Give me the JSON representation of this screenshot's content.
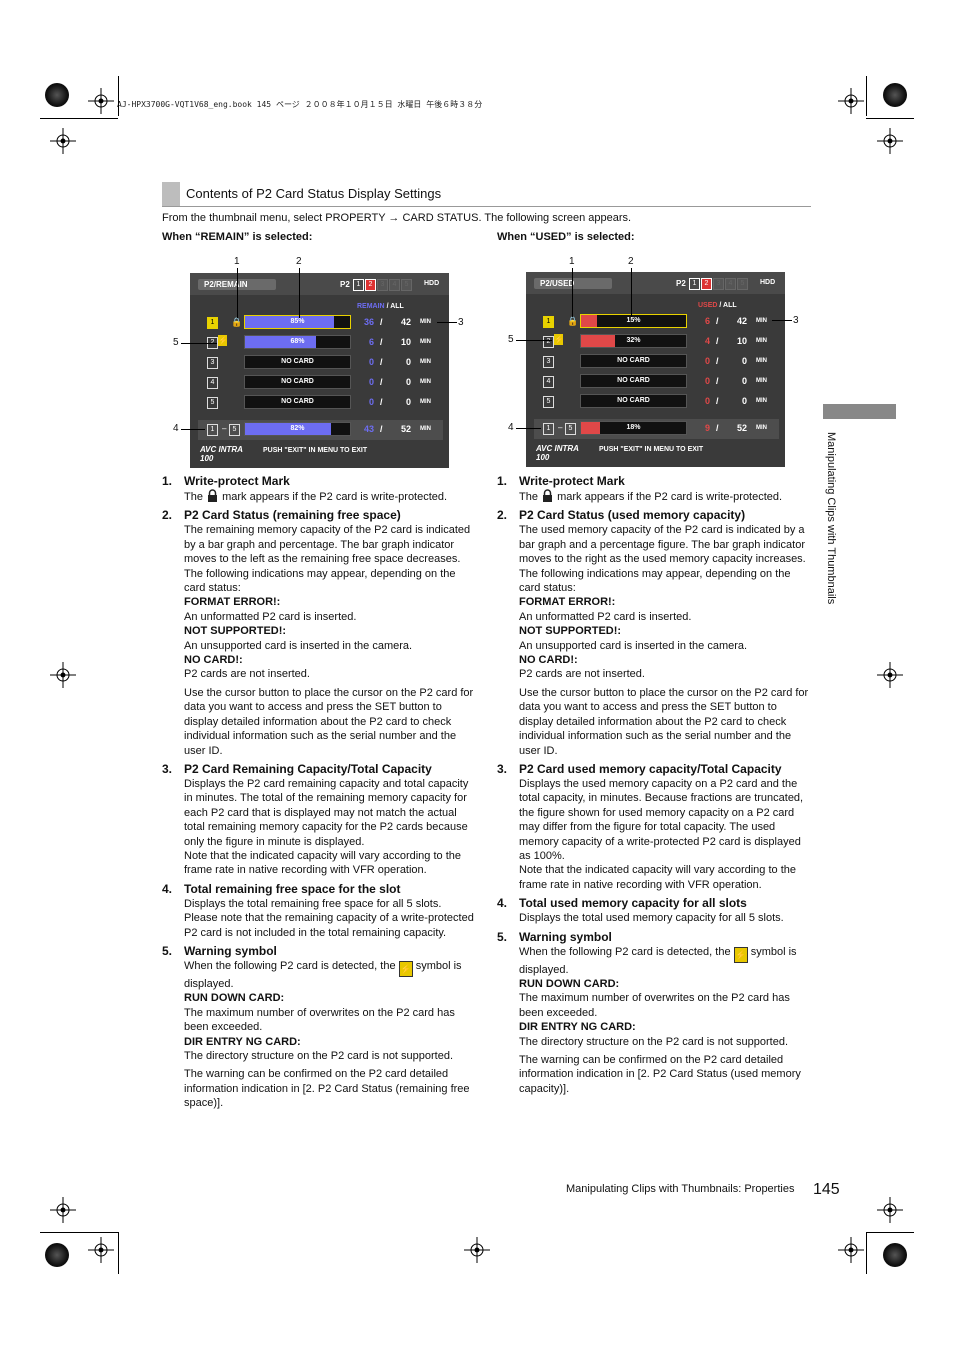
{
  "header_line": "AJ-HPX3700G-VQT1V68_eng.book  145 ページ  ２００８年１０月１５日  水曜日  午後６時３８分",
  "section_title": "Contents of P2 Card Status Display Settings",
  "intro": "From the thumbnail menu, select PROPERTY → CARD STATUS. The following screen appears.",
  "left_caption": "When “REMAIN” is selected:",
  "right_caption": "When “USED” is selected:",
  "screen_common": {
    "p2": "P2",
    "hdd": "HDD",
    "slash": "/",
    "min": "MIN",
    "all": "ALL",
    "push_exit": "PUSH \"EXIT\" IN MENU TO EXIT",
    "avc": "AVC INTRA 100",
    "total_from": "1",
    "total_to": "5",
    "slot_nums": [
      "1",
      "2",
      "3",
      "4",
      "5"
    ],
    "callouts": [
      "1",
      "2",
      "3",
      "4",
      "5"
    ]
  },
  "screen_remain": {
    "tab": "P2/REMAIN",
    "col_label": "REMAIN",
    "accent": "#6d6df2",
    "rows": [
      {
        "bar": "85%",
        "fill": 0.85,
        "v1": "36",
        "v2": "42"
      },
      {
        "bar": "68%",
        "fill": 0.68,
        "v1": "6",
        "v2": "10"
      },
      {
        "bar": "NO CARD",
        "fill": 0,
        "v1": "0",
        "v2": "0"
      },
      {
        "bar": "NO CARD",
        "fill": 0,
        "v1": "0",
        "v2": "0"
      },
      {
        "bar": "NO CARD",
        "fill": 0,
        "v1": "0",
        "v2": "0"
      }
    ],
    "total": {
      "bar": "82%",
      "fill": 0.82,
      "v1": "43",
      "v2": "52"
    }
  },
  "screen_used": {
    "tab": "P2/USED",
    "col_label": "USED",
    "accent": "#e04848",
    "rows": [
      {
        "bar": "15%",
        "fill": 0.15,
        "v1": "6",
        "v2": "42"
      },
      {
        "bar": "32%",
        "fill": 0.32,
        "v1": "4",
        "v2": "10"
      },
      {
        "bar": "NO CARD",
        "fill": 0,
        "v1": "0",
        "v2": "0"
      },
      {
        "bar": "NO CARD",
        "fill": 0,
        "v1": "0",
        "v2": "0"
      },
      {
        "bar": "NO CARD",
        "fill": 0,
        "v1": "0",
        "v2": "0"
      }
    ],
    "total": {
      "bar": "18%",
      "fill": 0.18,
      "v1": "9",
      "v2": "52"
    }
  },
  "left_items": {
    "i1": {
      "n": "1.",
      "title": "Write-protect Mark",
      "pre": "The",
      "post": "mark appears if the P2 card is write-protected."
    },
    "i2": {
      "n": "2.",
      "title": "P2 Card Status (remaining free space)",
      "p1": "The remaining memory capacity of the P2 card is indicated by a bar graph and percentage. The bar graph indicator moves to the left as the remaining free space decreases.",
      "p2": "The following indications may appear, depending on the card status:",
      "s1": "FORMAT ERROR!:",
      "s1d": "An unformatted P2 card is inserted.",
      "s2": "NOT SUPPORTED!:",
      "s2d": "An unsupported card is inserted in the camera.",
      "s3": "NO CARD!:",
      "s3d": "P2 cards are not inserted.",
      "p3": "Use the cursor button to place the cursor on the P2 card for data you want to access and press the SET button to display detailed information about the P2 card to check individual information such as the serial number and the user ID."
    },
    "i3": {
      "n": "3.",
      "title": "P2 Card Remaining Capacity/Total Capacity",
      "p1": "Displays the P2 card remaining capacity and total capacity in minutes. The total of the remaining memory capacity for each P2 card that is displayed may not match the actual total remaining memory capacity for the P2 cards because only the figure in minute is displayed.",
      "p2": "Note that the indicated capacity will vary according to the frame rate in native recording with VFR operation."
    },
    "i4": {
      "n": "4.",
      "title": "Total remaining free space for the slot",
      "p1": "Displays the total remaining free space for all 5 slots. Please note that the remaining capacity of a write-protected P2 card is not included in the total remaining capacity."
    },
    "i5": {
      "n": "5.",
      "title": "Warning symbol",
      "pre": "When the following P2 card is detected, the",
      "post": "symbol is displayed.",
      "s1": "RUN DOWN CARD:",
      "s1d": "The maximum number of overwrites on the P2 card has been exceeded.",
      "s2": "DIR ENTRY NG CARD:",
      "s2d": "The directory structure on the P2 card is not supported.",
      "p3": "The warning can be confirmed on the P2 card detailed information indication in [2. P2 Card Status (remaining free space)]."
    }
  },
  "right_items": {
    "i1": {
      "n": "1.",
      "title": "Write-protect Mark",
      "pre": "The",
      "post": "mark appears if the P2 card is write-protected."
    },
    "i2": {
      "n": "2.",
      "title": "P2 Card Status (used memory capacity)",
      "p1": "The used memory capacity of the P2 card is indicated by a bar graph and a percentage figure. The bar graph indicator moves to the right as the used memory capacity increases.",
      "p2": "The following indications may appear, depending on the card status:",
      "s1": "FORMAT ERROR!:",
      "s1d": "An unformatted P2 card is inserted.",
      "s2": "NOT SUPPORTED!:",
      "s2d": "An unsupported card is inserted in the camera.",
      "s3": "NO CARD!:",
      "s3d": "P2 cards are not inserted.",
      "p3": "Use the cursor button to place the cursor on the P2 card for data you want to access and press the SET button to display detailed information about the P2 card to check individual information such as the serial number and the user ID."
    },
    "i3": {
      "n": "3.",
      "title": "P2 Card used memory capacity/Total Capacity",
      "p1": "Displays the used memory capacity on a P2 card and the total capacity, in minutes. Because fractions are truncated, the figure shown for used memory capacity on a P2 card may differ from the figure for total capacity. The used memory capacity of a write-protected P2 card is displayed as 100%.",
      "p2": "Note that the indicated capacity will vary according to the frame rate in native recording with VFR operation."
    },
    "i4": {
      "n": "4.",
      "title": "Total used memory capacity for all slots",
      "p1": "Displays the total used memory capacity for all 5 slots."
    },
    "i5": {
      "n": "5.",
      "title": "Warning symbol",
      "pre": "When the following P2 card is detected, the",
      "post": "symbol is displayed.",
      "s1": "RUN DOWN CARD:",
      "s1d": "The maximum number of overwrites on the P2 card has been exceeded.",
      "s2": "DIR ENTRY NG CARD:",
      "s2d": "The directory structure on the P2 card is not supported.",
      "p3": "The warning can be confirmed on the P2 card detailed information indication in [2. P2 Card Status (used memory capacity)]."
    }
  },
  "side_tab": "Manipulating Clips with Thumbnails",
  "footer_text": "Manipulating Clips with Thumbnails: Properties",
  "page_number": "145"
}
